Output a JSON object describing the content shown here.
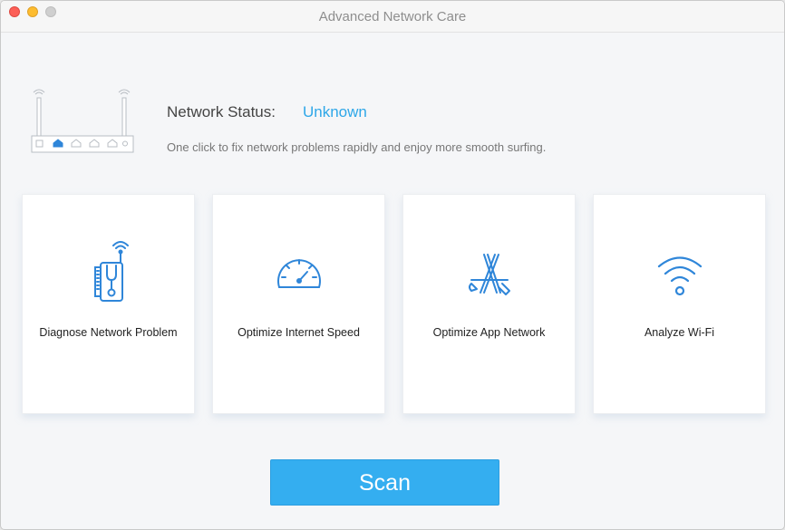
{
  "window": {
    "title": "Advanced Network Care",
    "buttons": [
      "close",
      "minimize",
      "zoom"
    ]
  },
  "status": {
    "label": "Network Status:",
    "value": "Unknown",
    "description": "One click to fix network problems rapidly and enjoy more smooth surfing."
  },
  "router_icon": "router-icon",
  "cards": [
    {
      "label": "Diagnose Network Problem",
      "icon": "stethoscope-device-icon"
    },
    {
      "label": "Optimize Internet Speed",
      "icon": "speedometer-icon"
    },
    {
      "label": "Optimize App Network",
      "icon": "app-store-tools-icon"
    },
    {
      "label": "Analyze Wi-Fi",
      "icon": "wifi-icon"
    }
  ],
  "scan": {
    "label": "Scan"
  },
  "colors": {
    "accent": "#2ea7e8",
    "button": "#34aef0",
    "icon": "#2f86d9",
    "background": "#f5f6f8"
  }
}
